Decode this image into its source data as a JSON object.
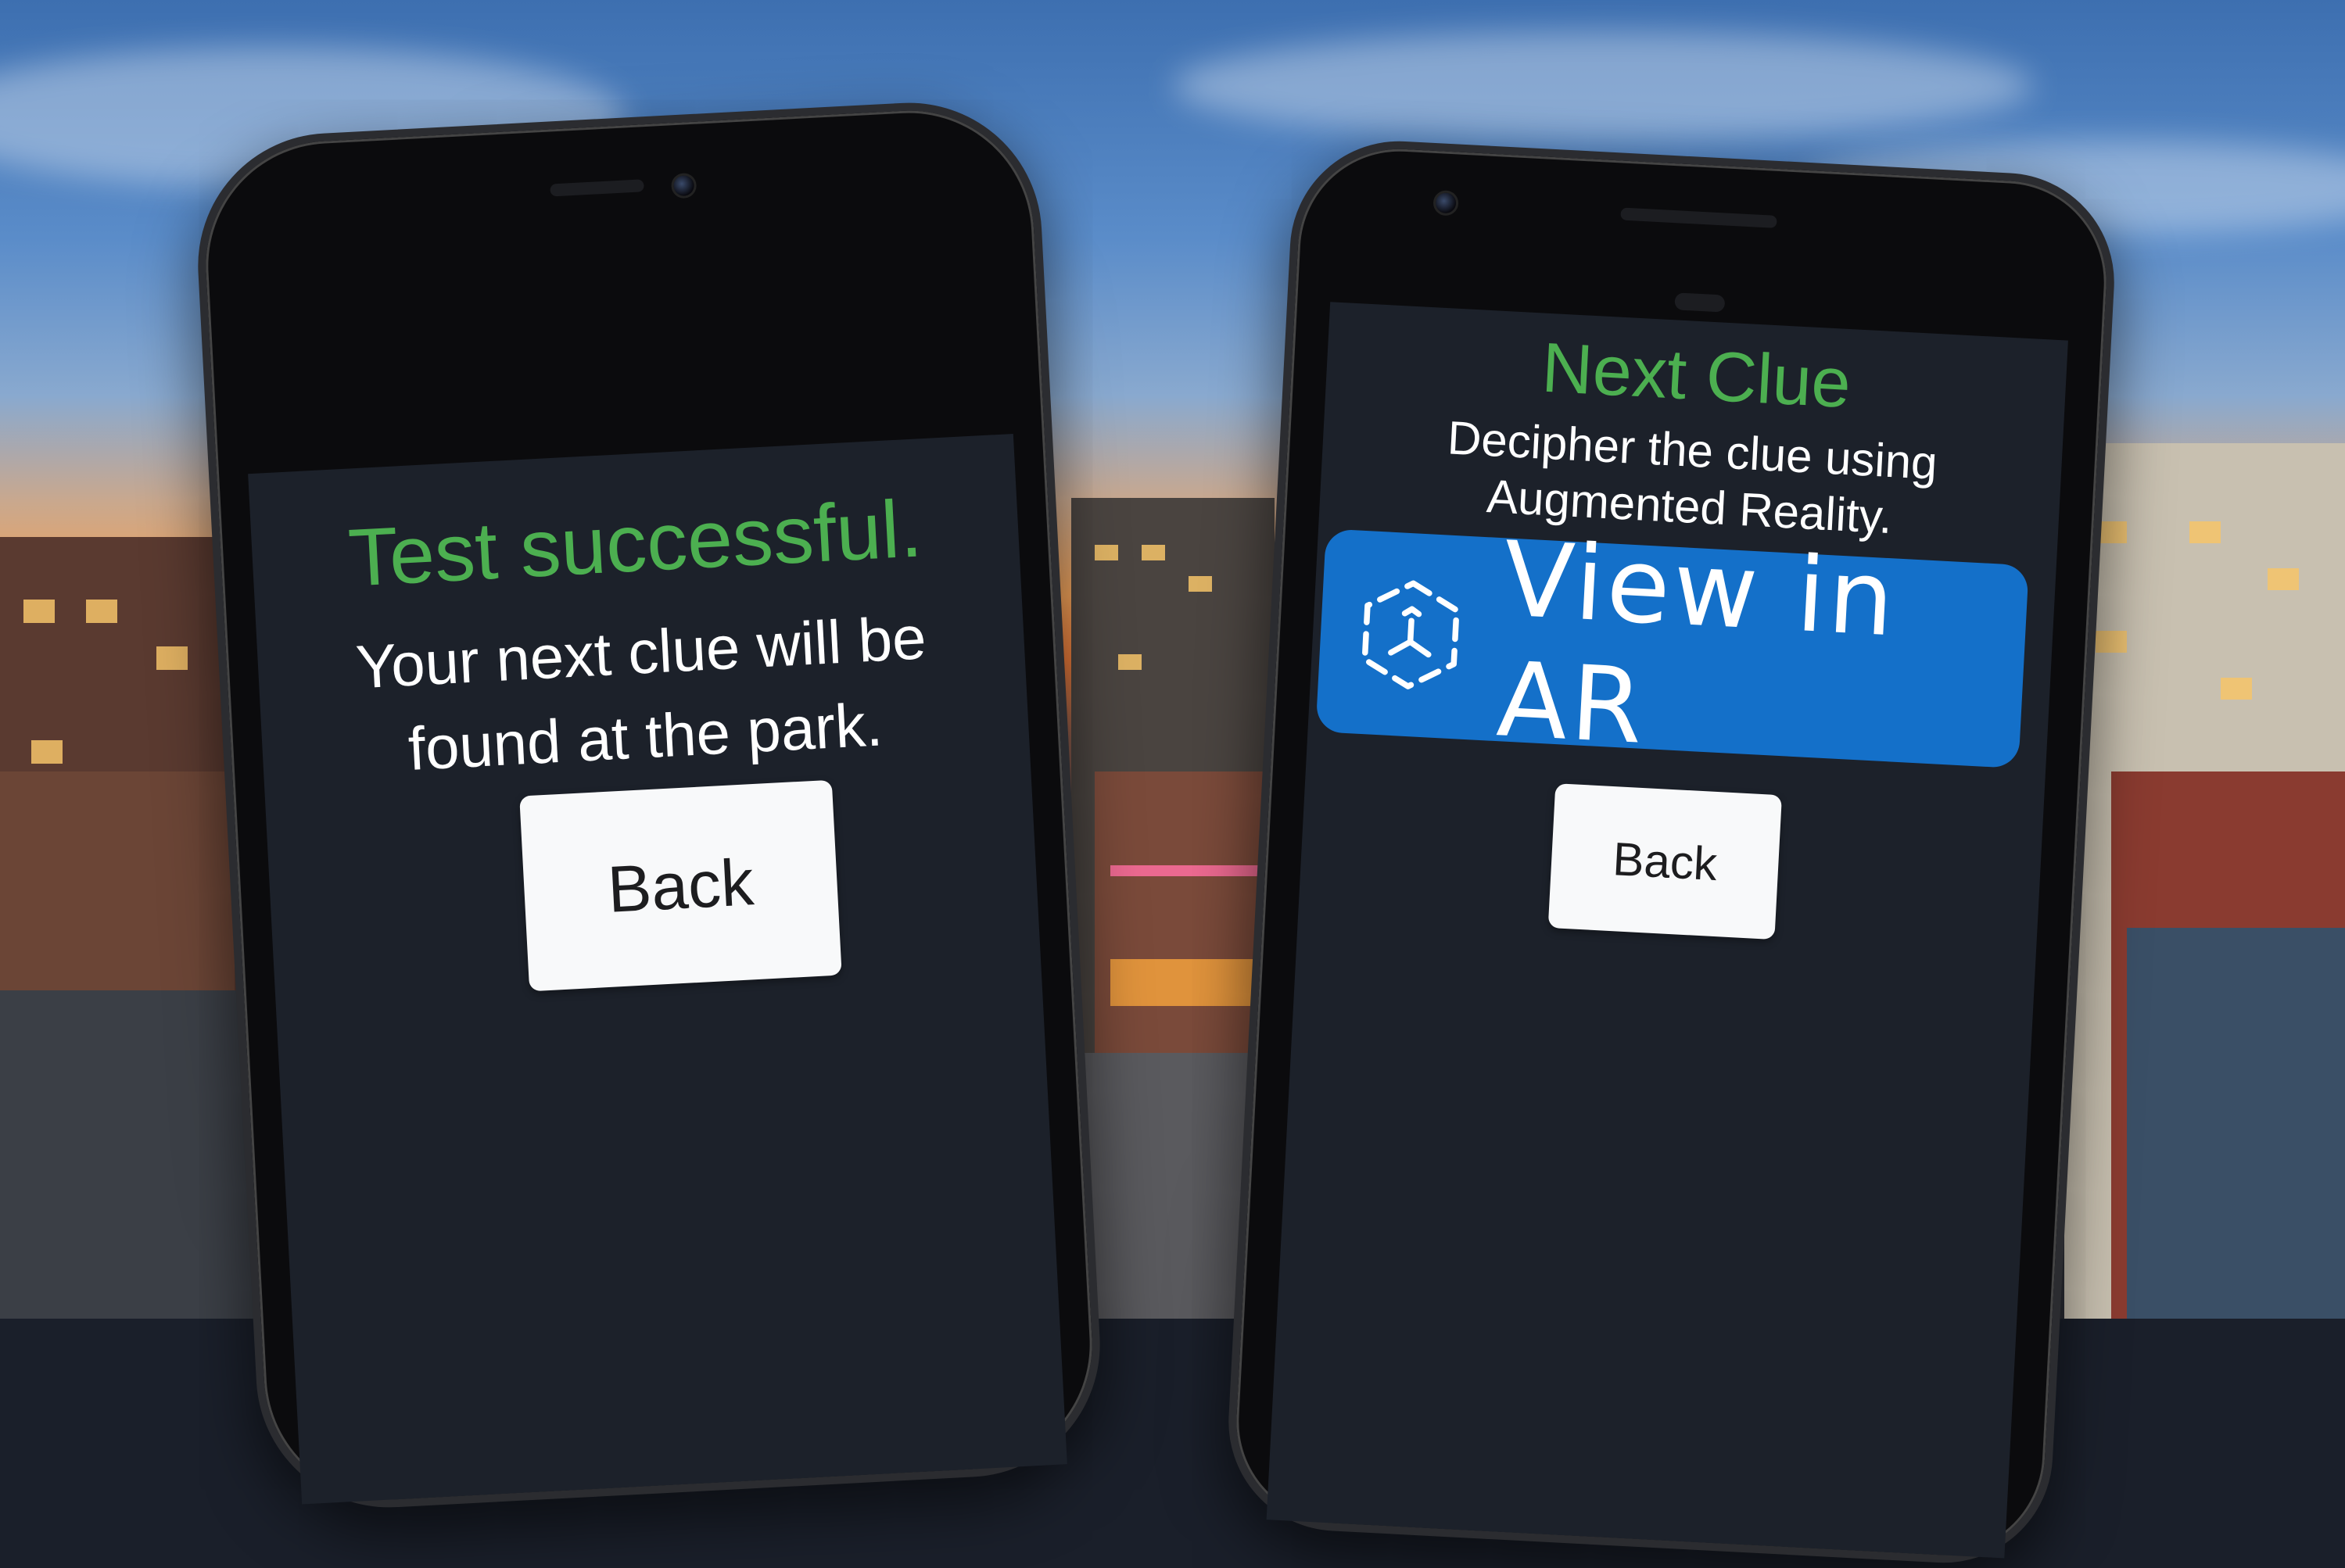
{
  "left_phone": {
    "title": "Test successful.",
    "message_line1": "Your next clue will be",
    "message_line2": "found at the park.",
    "back_label": "Back"
  },
  "right_phone": {
    "title": "Next Clue",
    "subtitle_line1": "Decipher the clue using",
    "subtitle_line2": "Augmented Reality.",
    "ar_button_label": "View in AR",
    "ar_icon": "ar-cube-icon",
    "back_label": "Back"
  },
  "colors": {
    "accent_green": "#4caf50",
    "ar_blue": "#1470c9",
    "screen_bg": "#1c212a",
    "button_bg": "#f8f9fa"
  }
}
